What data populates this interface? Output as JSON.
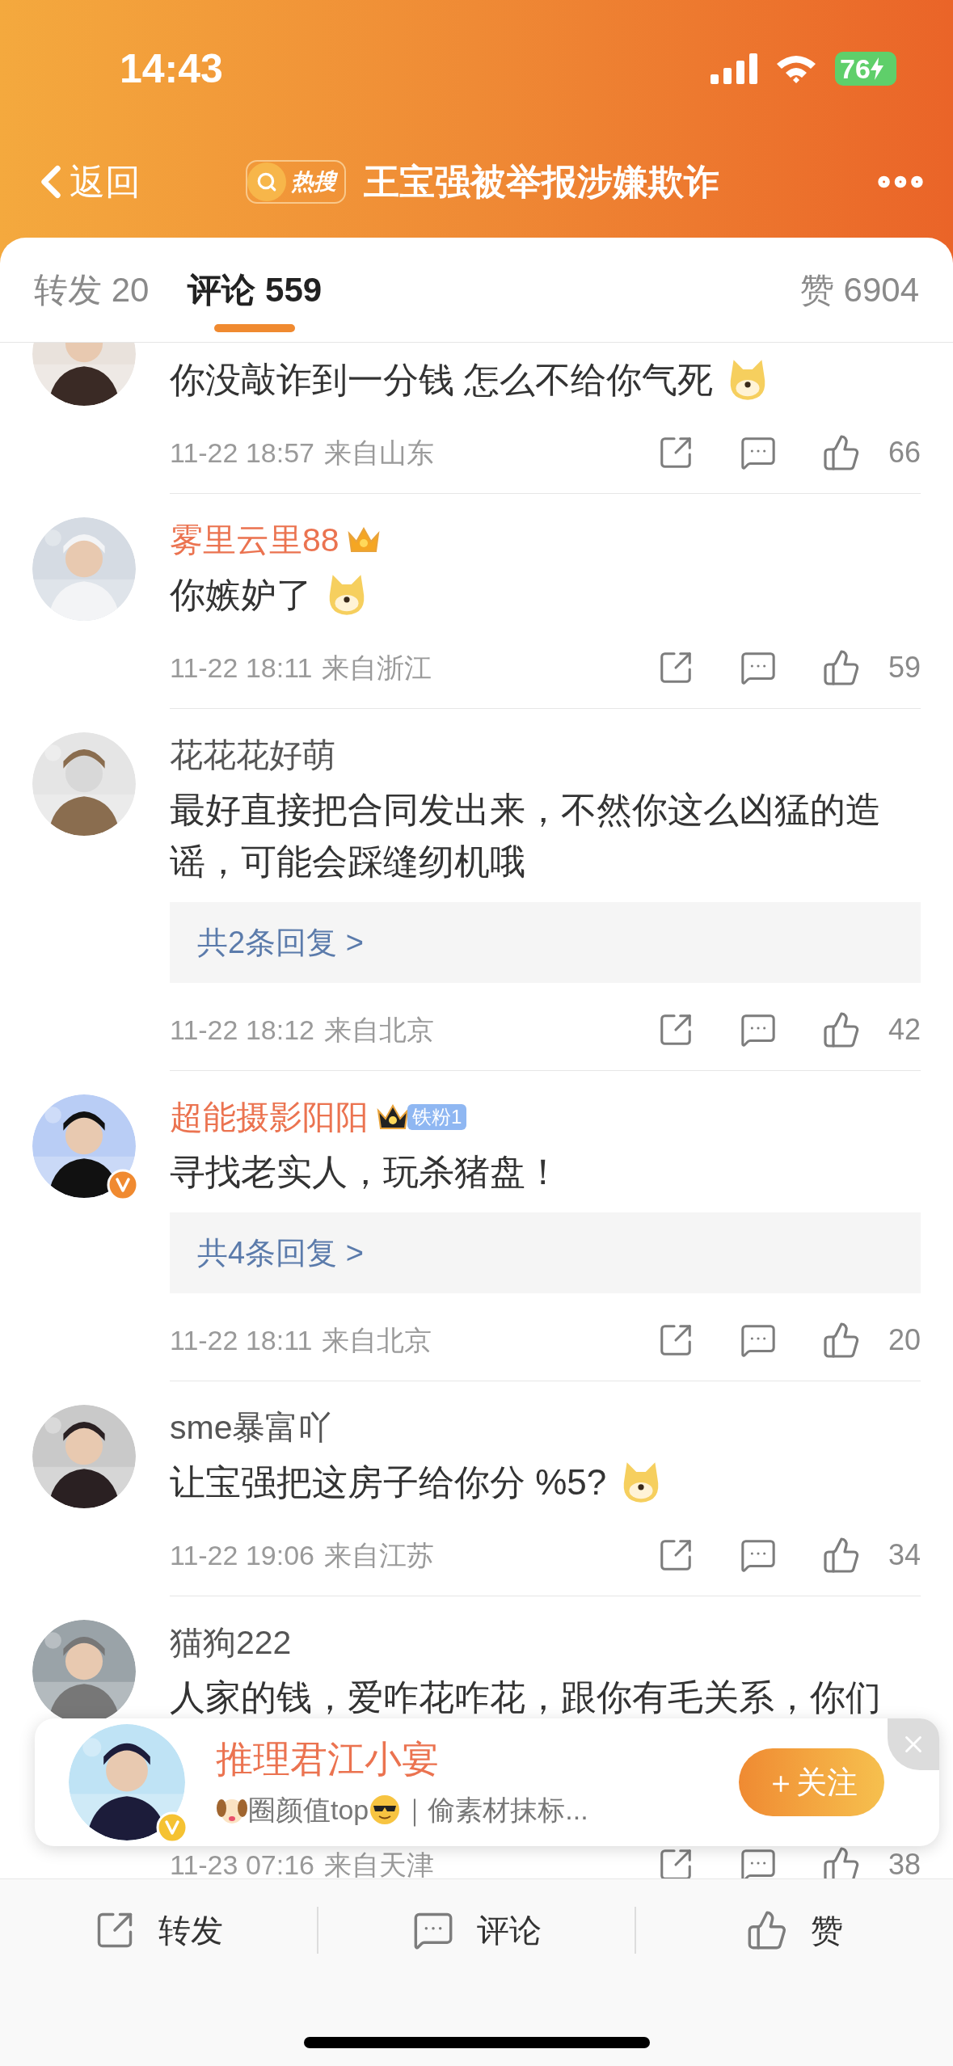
{
  "status_bar": {
    "time": "14:43",
    "battery": "76",
    "charging": true
  },
  "header": {
    "back": "返回",
    "badge": "热搜",
    "title": "王宝强被举报涉嫌欺诈"
  },
  "tabs": [
    {
      "label": "转发",
      "count": "20",
      "selected": false
    },
    {
      "label": "评论",
      "count": "559",
      "selected": true
    },
    {
      "label": "赞",
      "count": "6904",
      "selected": false
    }
  ],
  "comments": [
    {
      "text": "你没敲诈到一分钱 怎么不给你气死",
      "emoji": true,
      "time": "11-22 18:57",
      "location": "来自山东",
      "likes": "66"
    },
    {
      "name": "雾里云里88",
      "member": true,
      "badges": [
        {
          "kind": "crown",
          "color": "#f5a623"
        }
      ],
      "text": "你嫉妒了",
      "emoji": true,
      "time": "11-22 18:11",
      "location": "来自浙江",
      "likes": "59"
    },
    {
      "name": "花花花好萌",
      "member": false,
      "text": "最好直接把合同发出来，不然你这么凶猛的造谣，可能会踩缝纫机哦",
      "replies": "共2条回复 >",
      "time": "11-22 18:12",
      "location": "来自北京",
      "likes": "42"
    },
    {
      "name": "超能摄影阳阳",
      "member": true,
      "verified": true,
      "badges": [
        {
          "kind": "crown",
          "color": "#222222"
        },
        {
          "kind": "fan",
          "label": "铁粉1"
        }
      ],
      "text": "寻找老实人，玩杀猪盘！",
      "replies": "共4条回复 >",
      "time": "11-22 18:11",
      "location": "来自北京",
      "likes": "20"
    },
    {
      "name": "sme暴富吖",
      "member": false,
      "text": "让宝强把这房子给你分 %5? ",
      "emoji": true,
      "time": "11-22 19:06",
      "location": "来自江苏",
      "likes": "34"
    },
    {
      "name": "猫狗222",
      "member": false,
      "text": "人家的钱，爱咋花咋花，跟你有毛关系，你们",
      "time": "11-23 07:16",
      "location": "来自天津",
      "likes": "38"
    }
  ],
  "popup": {
    "name": "推理君江小宴",
    "verified": true,
    "bio": "圈颜值top",
    "bio_rest": "｜偷素材抹标...",
    "follow": "＋关注"
  },
  "bottom_bar": [
    {
      "kind": "share",
      "label": "转发"
    },
    {
      "kind": "comment",
      "label": "评论"
    },
    {
      "kind": "like",
      "label": "赞"
    }
  ]
}
